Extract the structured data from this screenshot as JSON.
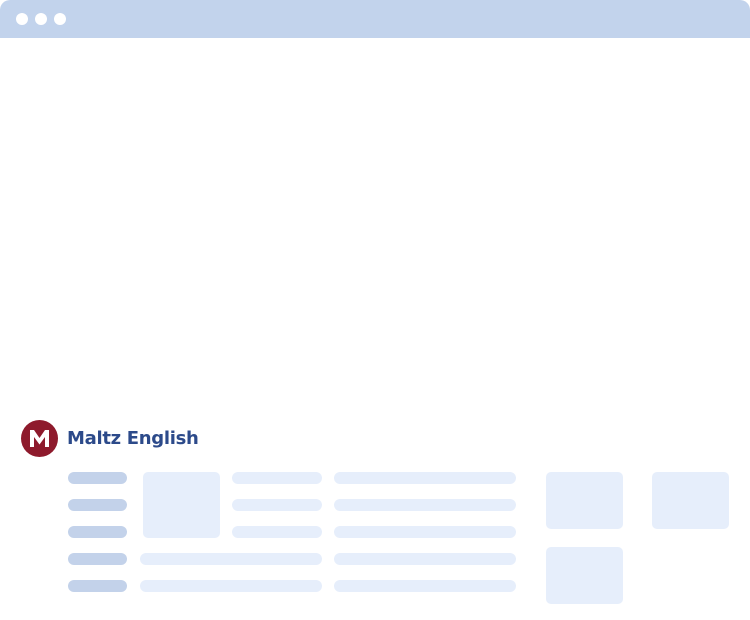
{
  "window": {
    "titlebar_color": "#c2d3ec",
    "controls": [
      "window-dot",
      "window-dot",
      "window-dot"
    ]
  },
  "brand": {
    "name": "Maltz English",
    "logo_letter": "M",
    "logo_color": "#8e1a2c",
    "name_color": "#2c4a8a"
  },
  "placeholders": {
    "accent_dark": "#c3d2ea",
    "accent_light": "#e6eefb"
  }
}
